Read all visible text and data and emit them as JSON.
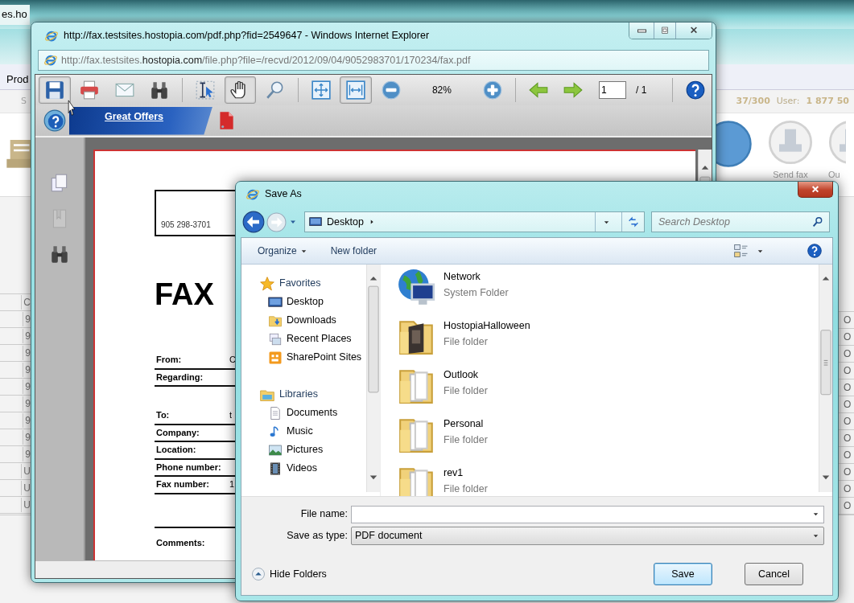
{
  "background_window": {
    "tab_text": "es.ho",
    "menu_item": "Prod",
    "nav_item": "S",
    "counter": "37/300",
    "user_label": "User:",
    "user_value": "1 877 50",
    "actions": [
      {
        "label": "Send fax"
      },
      {
        "label": "Ou"
      }
    ],
    "table": {
      "column_1": {
        "header": "C",
        "cells": [
          "9",
          "9",
          "9",
          "9",
          "9",
          "9",
          "9",
          "9",
          "9",
          "U",
          "U",
          "U"
        ]
      },
      "column_2": {
        "cells": [
          "O",
          "O",
          "O",
          "O",
          "O",
          "O",
          "O",
          "O",
          "O",
          "O",
          "O",
          "O"
        ]
      }
    }
  },
  "browser_window": {
    "title": "http://fax.testsites.hostopia.com/pdf.php?fid=2549647 - Windows Internet Explorer",
    "address": {
      "prefix": "http://fax.testsites.",
      "domain": "hostopia.com",
      "path": "/file.php?file=/recvd/2012/09/04/9052983701/170234/fax.pdf"
    },
    "tools": [
      {
        "kind": "save",
        "pressed": true
      },
      {
        "kind": "print",
        "pressed": false
      },
      {
        "kind": "email",
        "pressed": false
      },
      {
        "kind": "find",
        "pressed": false
      },
      {
        "kind": "separator"
      },
      {
        "kind": "select_text",
        "pressed": false
      },
      {
        "kind": "hand",
        "pressed": true
      },
      {
        "kind": "zoom_tool",
        "pressed": false
      },
      {
        "kind": "separator"
      },
      {
        "kind": "fit_page",
        "pressed": false
      },
      {
        "kind": "fit_width",
        "pressed": true
      },
      {
        "kind": "zoom_out",
        "pressed": false
      },
      {
        "kind": "zoom_level",
        "text": "82%"
      },
      {
        "kind": "zoom_in",
        "pressed": false
      },
      {
        "kind": "separator"
      },
      {
        "kind": "previous_page",
        "pressed": false
      },
      {
        "kind": "next_page",
        "pressed": false
      },
      {
        "kind": "page_number",
        "value": "1",
        "total": "/ 1"
      },
      {
        "kind": "separator"
      },
      {
        "kind": "help",
        "pressed": false
      }
    ],
    "banner": {
      "link": "Great Offers"
    },
    "sidebar_tools": [
      {
        "kind": "pages",
        "disabled": false
      },
      {
        "kind": "bookmarks",
        "disabled": true
      },
      {
        "kind": "find",
        "disabled": false
      }
    ],
    "document": {
      "phone": "905 298-3701",
      "heading": "FAX",
      "sender_fields": [
        {
          "label": "From:",
          "value": "C"
        },
        {
          "label": "Regarding:"
        }
      ],
      "recipient_fields": [
        {
          "label": "To:",
          "value": "t"
        },
        {
          "label": "Company:"
        },
        {
          "label": "Location:"
        },
        {
          "label": "Phone number:"
        },
        {
          "label": "Fax number:",
          "value": "1"
        }
      ],
      "comments_label": "Comments:"
    }
  },
  "save_dialog": {
    "title": "Save As",
    "path": [
      "Desktop"
    ],
    "search": {
      "placeholder": "Search Desktop"
    },
    "commands": [
      {
        "label": "Organize",
        "menu": true
      },
      {
        "label": "New folder",
        "menu": false
      }
    ],
    "nav_tree": [
      {
        "label": "Favorites",
        "kind": "favorites",
        "children": [
          {
            "label": "Desktop",
            "kind": "desktop"
          },
          {
            "label": "Downloads",
            "kind": "downloads"
          },
          {
            "label": "Recent Places",
            "kind": "recent"
          },
          {
            "label": "SharePoint Sites",
            "kind": "sharepoint"
          }
        ]
      },
      {
        "label": "Libraries",
        "kind": "libraries",
        "children": [
          {
            "label": "Documents",
            "kind": "documents"
          },
          {
            "label": "Music",
            "kind": "music"
          },
          {
            "label": "Pictures",
            "kind": "pictures"
          },
          {
            "label": "Videos",
            "kind": "videos"
          }
        ]
      }
    ],
    "files": [
      {
        "name": "Network",
        "type": "System Folder",
        "kind": "network"
      },
      {
        "name": "HostopiaHalloween",
        "type": "File folder",
        "kind": "photo_folder"
      },
      {
        "name": "Outlook",
        "type": "File folder",
        "kind": "folder"
      },
      {
        "name": "Personal",
        "type": "File folder",
        "kind": "folder"
      },
      {
        "name": "rev1",
        "type": "File folder",
        "kind": "folder"
      }
    ],
    "file_name": {
      "label": "File name:"
    },
    "save_type": {
      "label": "Save as type:",
      "value": "PDF document"
    },
    "hide_folders": "Hide Folders",
    "buttons": [
      {
        "label": "Save",
        "default": true
      },
      {
        "label": "Cancel",
        "default": false
      }
    ]
  }
}
